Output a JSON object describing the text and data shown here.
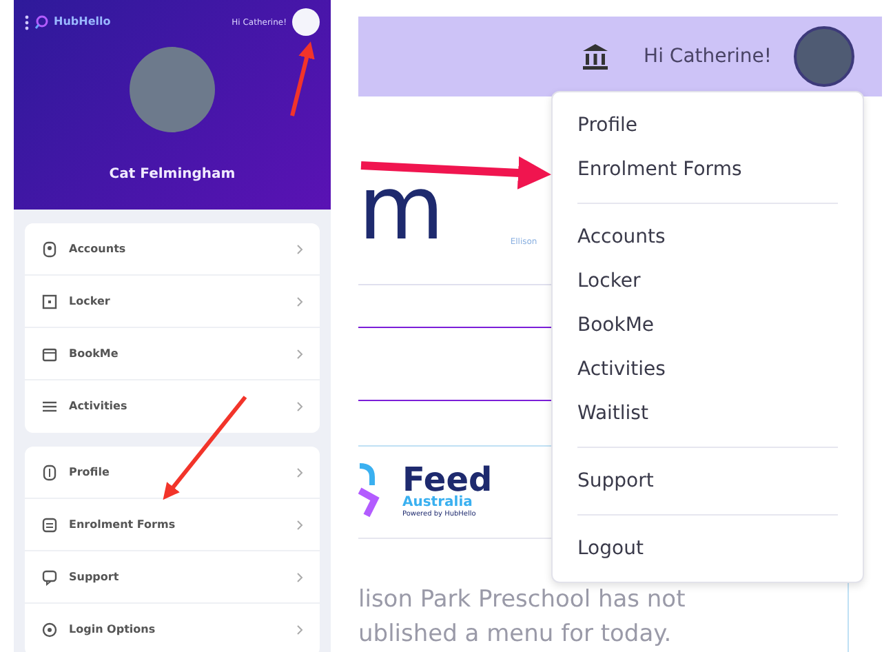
{
  "mobile": {
    "brand": "HubHello",
    "greeting": "Hi Catherine!",
    "user_name": "Cat Felmingham",
    "menu_groups": [
      [
        {
          "label": "Accounts"
        },
        {
          "label": "Locker"
        },
        {
          "label": "BookMe"
        },
        {
          "label": "Activities"
        }
      ],
      [
        {
          "label": "Profile"
        },
        {
          "label": "Enrolment Forms"
        },
        {
          "label": "Support"
        },
        {
          "label": "Login Options"
        }
      ]
    ]
  },
  "desktop": {
    "greeting": "Hi Catherine!",
    "heading_fragment": "m",
    "school_logo_text": "Ellison",
    "dropdown_groups": [
      [
        {
          "label": "Profile"
        },
        {
          "label": "Enrolment Forms"
        }
      ],
      [
        {
          "label": "Accounts"
        },
        {
          "label": "Locker"
        },
        {
          "label": "BookMe"
        },
        {
          "label": "Activities"
        },
        {
          "label": "Waitlist"
        }
      ],
      [
        {
          "label": "Support"
        }
      ],
      [
        {
          "label": "Logout"
        }
      ]
    ],
    "feed_logo": {
      "title": "Feed",
      "subtitle": "Australia",
      "tagline": "Powered by HubHello"
    },
    "message": [
      "lison Park Preschool has not",
      "ublished a menu for today."
    ]
  }
}
